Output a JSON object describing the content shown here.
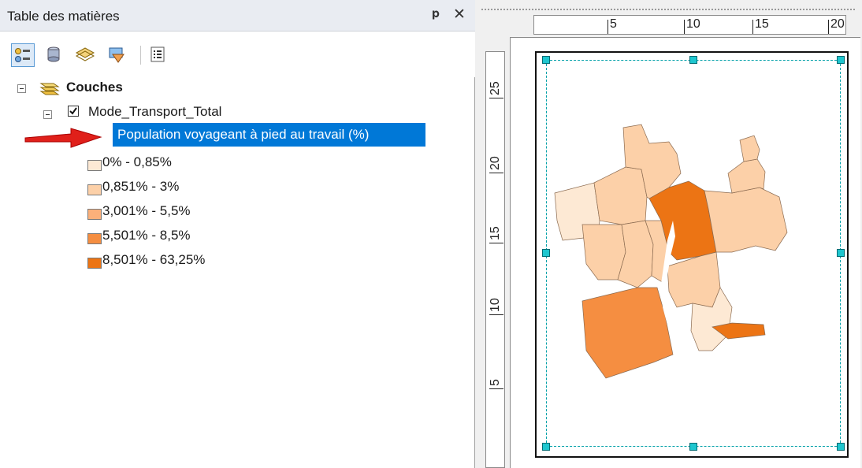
{
  "toc": {
    "title": "Table des matières",
    "pin": "ᵖ",
    "close": "✕",
    "toolbar": [
      "list-by-drawing-order-icon",
      "list-by-source-icon",
      "list-by-visibility-icon",
      "list-by-selection-icon",
      "options-icon"
    ]
  },
  "tree": {
    "root": "Couches",
    "layer": "Mode_Transport_Total",
    "field": "Population voyageant à pied au travail (%)",
    "classes": [
      {
        "label": "0% - 0,85%",
        "color": "#fde9d4"
      },
      {
        "label": "0,851% - 3%",
        "color": "#fcd0a8"
      },
      {
        "label": "3,001% - 5,5%",
        "color": "#fbb07a"
      },
      {
        "label": "5,501% - 8,5%",
        "color": "#f58e41"
      },
      {
        "label": "8,501% - 63,25%",
        "color": "#ec7414"
      }
    ]
  },
  "ruler": {
    "horizontal": [
      "5",
      "10",
      "15",
      "20"
    ],
    "vertical": [
      "25",
      "20",
      "15",
      "10",
      "5"
    ]
  },
  "colors": {
    "selection": "#0078d7",
    "arrow": "#e0201a",
    "handle": "#1ec6cf"
  }
}
